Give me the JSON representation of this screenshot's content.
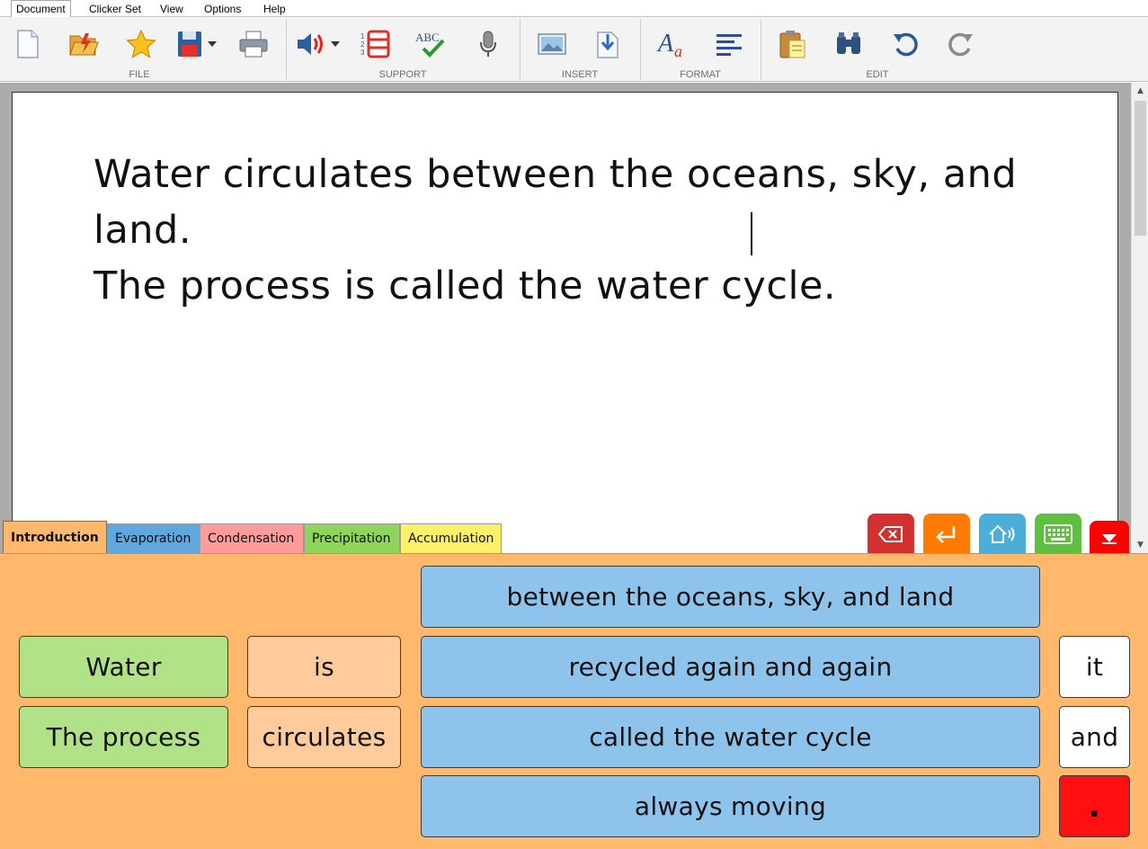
{
  "menubar": {
    "items": [
      "Document",
      "Clicker Set",
      "View",
      "Options",
      "Help"
    ],
    "active": "Document"
  },
  "ribbon": {
    "groups": [
      {
        "label": "FILE",
        "tools": [
          "new-document-icon",
          "open-folder-icon",
          "favorite-star-icon",
          "save-disk-icon",
          "print-icon"
        ]
      },
      {
        "label": "SUPPORT",
        "tools": [
          "speech-volume-icon",
          "numbered-list-icon",
          "spell-check-icon",
          "microphone-icon"
        ]
      },
      {
        "label": "INSERT",
        "tools": [
          "insert-picture-icon",
          "insert-file-icon"
        ]
      },
      {
        "label": "FORMAT",
        "tools": [
          "font-format-icon",
          "align-left-icon"
        ]
      },
      {
        "label": "EDIT",
        "tools": [
          "paste-clipboard-icon",
          "find-binoculars-icon",
          "undo-icon",
          "redo-icon"
        ]
      }
    ],
    "spellcheck_text": "ABC",
    "font_glyph_a": "A",
    "font_glyph_b": "a"
  },
  "document": {
    "line1": "Water circulates between the oceans, sky, and land.",
    "line2": "The process is called the water cycle."
  },
  "set_tabs": [
    {
      "label": "Introduction",
      "color": "#ffb86c"
    },
    {
      "label": "Evaporation",
      "color": "#5fa8dd"
    },
    {
      "label": "Condensation",
      "color": "#ff9b9b"
    },
    {
      "label": "Precipitation",
      "color": "#8ed65a"
    },
    {
      "label": "Accumulation",
      "color": "#fff06a"
    }
  ],
  "action_buttons": [
    {
      "name": "backspace-icon",
      "color": "#d2312f"
    },
    {
      "name": "enter-return-icon",
      "color": "#ff7a00"
    },
    {
      "name": "speak-house-icon",
      "color": "#4aaed8"
    },
    {
      "name": "keyboard-icon",
      "color": "#5fbf3e"
    },
    {
      "name": "collapse-down-icon",
      "color": "#ff0000"
    }
  ],
  "grid": {
    "subjects": [
      "Water",
      "The process"
    ],
    "verbs": [
      "is",
      "circulates"
    ],
    "phrases": [
      "between the oceans, sky, and land",
      "recycled again and again",
      "called the water cycle",
      "always moving"
    ],
    "extras": [
      "it",
      "and",
      "."
    ]
  },
  "colors": {
    "panel_bg": "#ffb86c",
    "subject": "#b1e288",
    "verb": "#ffcb9a",
    "phrase": "#8ec4ec",
    "extra": "#ffffff",
    "full_stop": "#ff0f0f"
  }
}
